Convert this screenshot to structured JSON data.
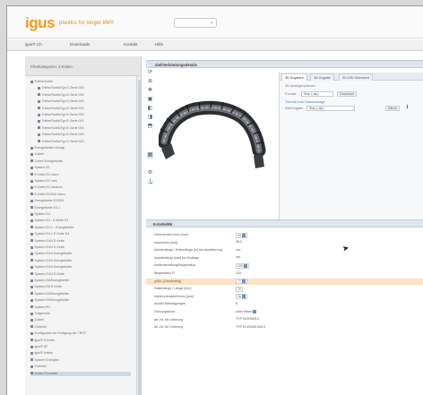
{
  "header": {
    "logo_text": "igus",
    "tagline": "plastics for longer life®"
  },
  "menubar": {
    "items": [
      "igus® Ch.",
      "Downloads",
      "Kontakt",
      "Hilfe"
    ]
  },
  "sidebar": {
    "title": "Filterkategorien: 3 Ketten",
    "tree": [
      "Triebe/Sortik",
      "Triebe/Sortik/Typ E-Serie 003",
      "Triebe/Sortik/Typ E-Serie 003",
      "Triebe/Sortik/Typ E-Serie 003",
      "Triebe/Sortik/Typ E-Serie 003",
      "Triebe/Sortik/Typ E-Serie 003",
      "Triebe/Sortik/Typ E-Serie 003",
      "Triebe/Sortik/Typ E-Serie 003",
      "Triebe/Sortik/Typ E-Serie 003",
      "Triebe/Sortik/Typ E-Serie 003",
      "Energieketten  Energi",
      "Zubeh",
      "Zubeh Energiekette",
      "System E1",
      "E-Kette E2 micro",
      "System E2 mini",
      "E-Kette E2 medium",
      "E-Kette E2/000 micro",
      "Energiekette E2/000",
      "Energiekette E4.1",
      "System E4",
      "System E4 - E-Kette E4",
      "System E4.1 - Energiekette",
      "System E4.1 E-Kette E4",
      "System E4/4 E-Kette",
      "System E4/4 E-Kette",
      "System E4/4 Energiekette",
      "System E4/4 Energiekette",
      "System E4/4 Energiekette",
      "System E4/4 E-Kette",
      "System E6/Energiekette",
      "System E6 E-Kette",
      "System E6/Energiekette",
      "System E6/Energiekette",
      "System R1",
      "Trägerrolle",
      "Zubeh",
      "Zubehör",
      "Konfigurator für Fertigung der TRCF",
      "igus® E-Kette",
      "igus® KF",
      "igus® Ketten",
      "System Energiek",
      "Zubehör",
      "Ketten Produkte"
    ],
    "selected_index": 44
  },
  "top_panel": {
    "title": "Ziel/Verbindungsdetails",
    "tabs": [
      "3D Zuganze",
      "3D Zugabe",
      "3D-DIN Übersicht"
    ],
    "section_label": "3D Anzeigeoptionen",
    "format_label": "Format",
    "format_value": "Step  (.stp)",
    "format_button": "Download",
    "link1": "Tutorial-Link",
    "link2": "Datenvorlage",
    "view_label": "Zeit/Zugabe",
    "view_value": "Step  (.stp)",
    "view_button": "Öffnen"
  },
  "bottom_panel": {
    "title": "E-Kette/Rk",
    "rows": [
      {
        "label": "Kettenbreite Innen [mm]",
        "value": "44",
        "box": true,
        "dd": true
      },
      {
        "label": "Innenhöhe [mm]",
        "value": "28.0",
        "box": false,
        "dd": false
      },
      {
        "label": "Anlieferlänge / Kettenlänge [m] bei Auslieferung",
        "value": "xxx",
        "box": false,
        "dd": false
      },
      {
        "label": "Ausfahrlänge [mm] bei Endlage",
        "value": "xxx",
        "box": false,
        "dd": false
      },
      {
        "label": "Anfahrtsrichtung/Biegeradius",
        "value": "125",
        "box": true,
        "dd": true
      },
      {
        "label": "Biegeradius R",
        "value": "125",
        "box": false,
        "dd": false
      },
      {
        "label": "g/Stk. [Gewicht/kg]",
        "value": "??",
        "box": true,
        "dd": true
      },
      {
        "label": "Rasterlänge / Länge [mm]",
        "value": "70",
        "box": true,
        "dd": false
      },
      {
        "label": "Kabelvollmaske/Innen [mm]",
        "value": "Ja",
        "box": true,
        "dd": true
      },
      {
        "label": "Anzahl Befestigungen",
        "value": "8",
        "box": false,
        "dd": false
      },
      {
        "label": "Führungsrinne",
        "value": "ohne Rinne",
        "box": false,
        "dd": true
      },
      {
        "label": "art.-Nr. für Lieferung",
        "value": "TYP 03.E0x05.0",
        "box": false,
        "dd": false
      },
      {
        "label": "art.-Nr. für Lieferung",
        "value": "TYP 03.E0x05.005.0",
        "box": false,
        "dd": false
      }
    ],
    "highlight_index": 6
  },
  "colors": {
    "brand": "#f39a1e",
    "highlight": "#fbe3c3",
    "panel_header": "#dfe5ec",
    "link": "#4a7cbf"
  }
}
